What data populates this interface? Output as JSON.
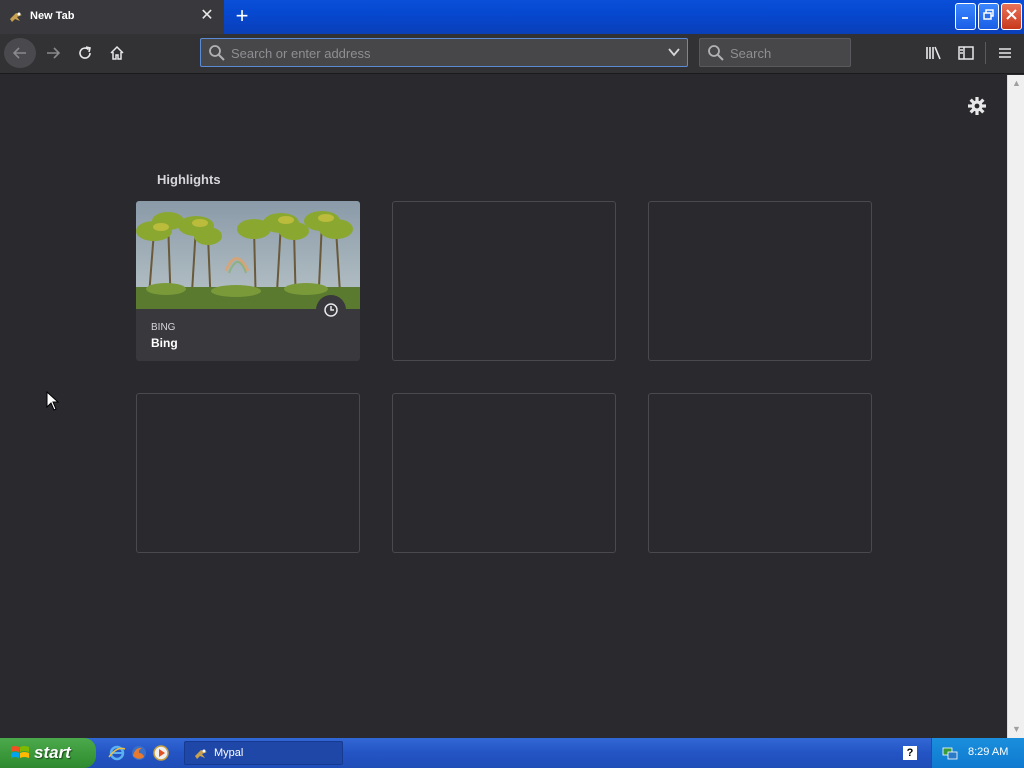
{
  "tab": {
    "title": "New Tab"
  },
  "toolbar": {
    "url_placeholder": "Search or enter address",
    "search_placeholder": "Search"
  },
  "highlights": {
    "title": "Highlights",
    "cards": [
      {
        "host": "BING",
        "title": "Bing",
        "has_image": true
      }
    ],
    "empty_slots": 5
  },
  "taskbar": {
    "start_label": "start",
    "task_label": "Mypal",
    "help": "?",
    "clock": "8:29 AM"
  },
  "colors": {
    "tab_active": "#38383d",
    "page_bg": "#2a2a2e",
    "url_focus_border": "#5c8bd6",
    "taskbar_blue": "#2454c4",
    "start_green": "#3c9a3c"
  },
  "icons": [
    "back-icon",
    "forward-icon",
    "reload-icon",
    "home-icon",
    "search-icon",
    "dropdown-icon",
    "library-icon",
    "sidebar-icon",
    "menu-icon",
    "gear-icon",
    "clock-icon",
    "start-logo-icon",
    "ie-icon",
    "firefox-icon",
    "media-icon",
    "network-icon"
  ]
}
